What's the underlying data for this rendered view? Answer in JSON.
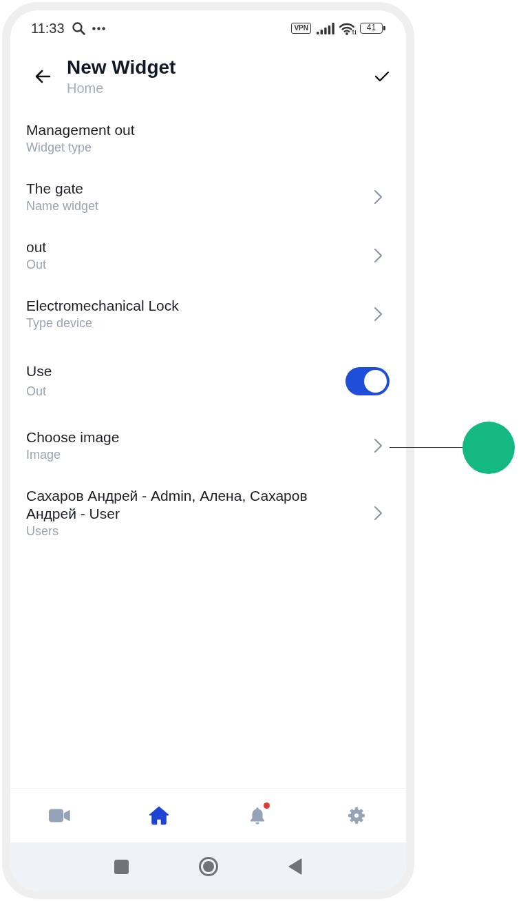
{
  "status_bar": {
    "time": "11:33",
    "vpn": "VPN",
    "battery": "41"
  },
  "header": {
    "title": "New Widget",
    "subtitle": "Home"
  },
  "rows": [
    {
      "kind": "info",
      "title": "Management out",
      "subtitle": "Widget type",
      "callout": false
    },
    {
      "kind": "link",
      "title": "The gate",
      "subtitle": "Name widget",
      "callout": false
    },
    {
      "kind": "link",
      "title": "out",
      "subtitle": "Out",
      "callout": false
    },
    {
      "kind": "link",
      "title": "Electromechanical Lock",
      "subtitle": "Type device",
      "callout": false
    },
    {
      "kind": "switch",
      "title": "Use",
      "subtitle": "Out",
      "on": true,
      "callout": false
    },
    {
      "kind": "link",
      "title": "Choose image",
      "subtitle": "Image",
      "callout": true
    },
    {
      "kind": "link",
      "title": "Сахаров Андрей - Admin, Алена, Сахаров Андрей - User",
      "subtitle": "Users",
      "callout": false
    }
  ],
  "bottom_nav": [
    {
      "selected": false,
      "notification": false
    },
    {
      "selected": true,
      "notification": false
    },
    {
      "selected": false,
      "notification": true
    },
    {
      "selected": false,
      "notification": false
    }
  ]
}
